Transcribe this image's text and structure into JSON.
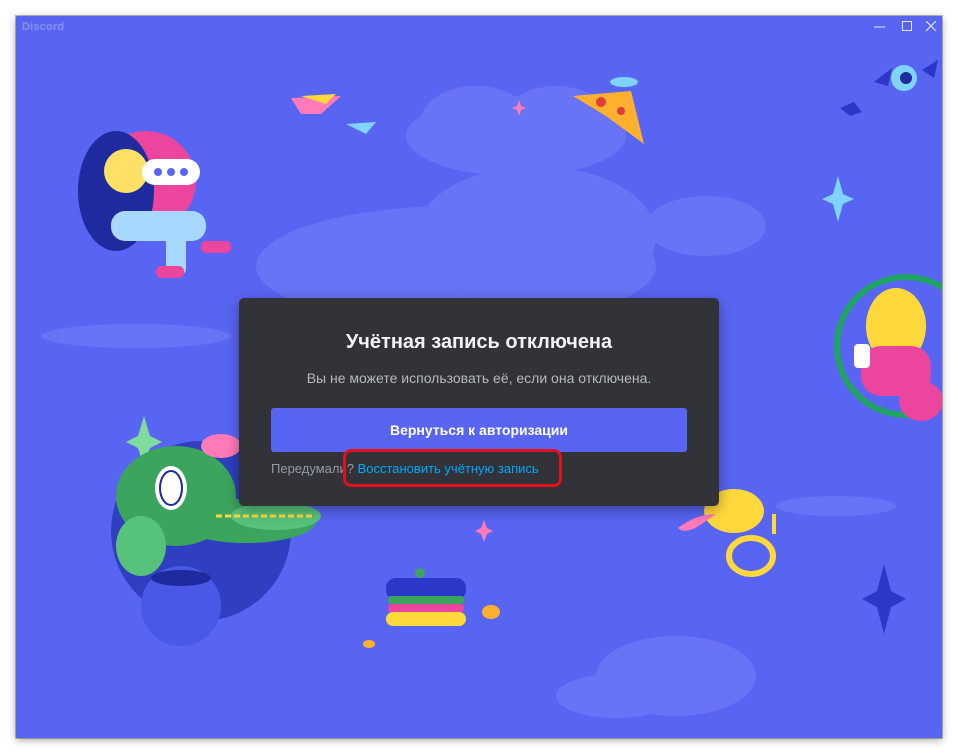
{
  "window": {
    "app_title": "Discord",
    "controls": {
      "minimize_icon": "minimize-icon",
      "maximize_icon": "maximize-icon",
      "close_icon": "close-icon"
    }
  },
  "modal": {
    "title": "Учётная запись отключена",
    "subtitle": "Вы не можете использовать её, если она отключена.",
    "primary_button": "Вернуться к авторизации",
    "footer_prefix": "Передумали?",
    "footer_link": "Восстановить учётную запись"
  },
  "colors": {
    "background": "#5865f2",
    "modal": "#313338",
    "button": "#5865f2",
    "link": "#00a8fc",
    "highlight": "#e0111b"
  }
}
